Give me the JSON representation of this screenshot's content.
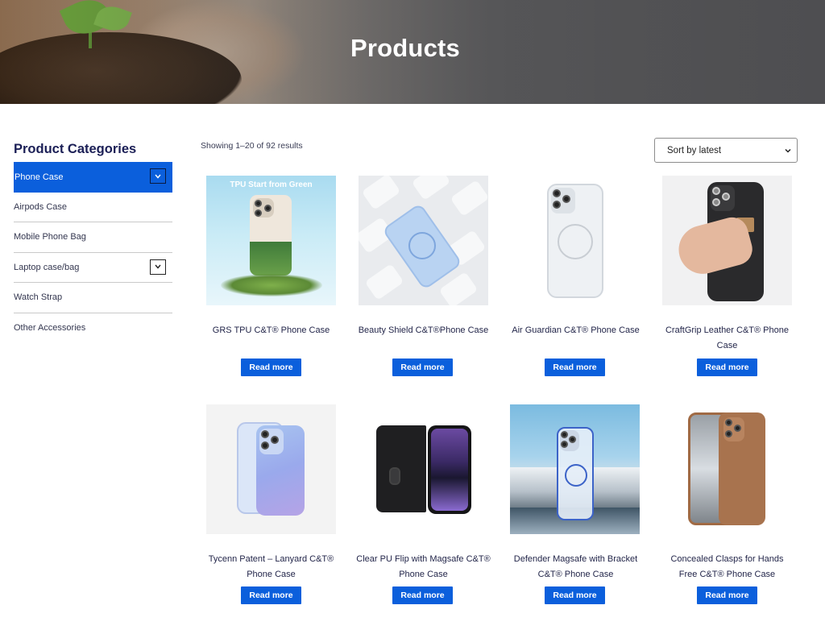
{
  "hero": {
    "title": "Products"
  },
  "sidebar": {
    "heading": "Product Categories",
    "items": [
      {
        "label": "Phone Case",
        "active": true,
        "has_toggle": true
      },
      {
        "label": "Airpods Case",
        "active": false,
        "has_toggle": false
      },
      {
        "label": "Mobile Phone Bag",
        "active": false,
        "has_toggle": false
      },
      {
        "label": "Laptop case/bag",
        "active": false,
        "has_toggle": true
      },
      {
        "label": "Watch Strap",
        "active": false,
        "has_toggle": false
      },
      {
        "label": "Other Accessories",
        "active": false,
        "has_toggle": false
      }
    ]
  },
  "toolbar": {
    "results_text": "Showing 1–20 of 92 results",
    "sort_selected": "Sort by latest"
  },
  "products": [
    {
      "name_line1": "GRS TPU C&T® Phone Case",
      "name_line2": "",
      "button": "Read more",
      "image_caption": "TPU Start from Green"
    },
    {
      "name_line1": "Beauty Shield C&T®Phone Case",
      "name_line2": "",
      "button": "Read more"
    },
    {
      "name_line1": "Air Guardian C&T® Phone Case",
      "name_line2": "",
      "button": "Read more"
    },
    {
      "name_line1": "CraftGrip Leather C&T® Phone",
      "name_line2": "Case",
      "button": "Read more"
    },
    {
      "name_line1": "Tycenn Patent – Lanyard C&T®",
      "name_line2": "Phone Case",
      "button": "Read more"
    },
    {
      "name_line1": "Clear PU Flip with Magsafe C&T®",
      "name_line2": "Phone Case",
      "button": "Read more"
    },
    {
      "name_line1": "Defender Magsafe with Bracket",
      "name_line2": "C&T® Phone Case",
      "button": "Read more"
    },
    {
      "name_line1": "Concealed Clasps for Hands",
      "name_line2": "Free C&T® Phone Case",
      "button": "Read more"
    }
  ],
  "colors": {
    "accent": "#0b5fdc",
    "heading": "#1b1f56"
  }
}
